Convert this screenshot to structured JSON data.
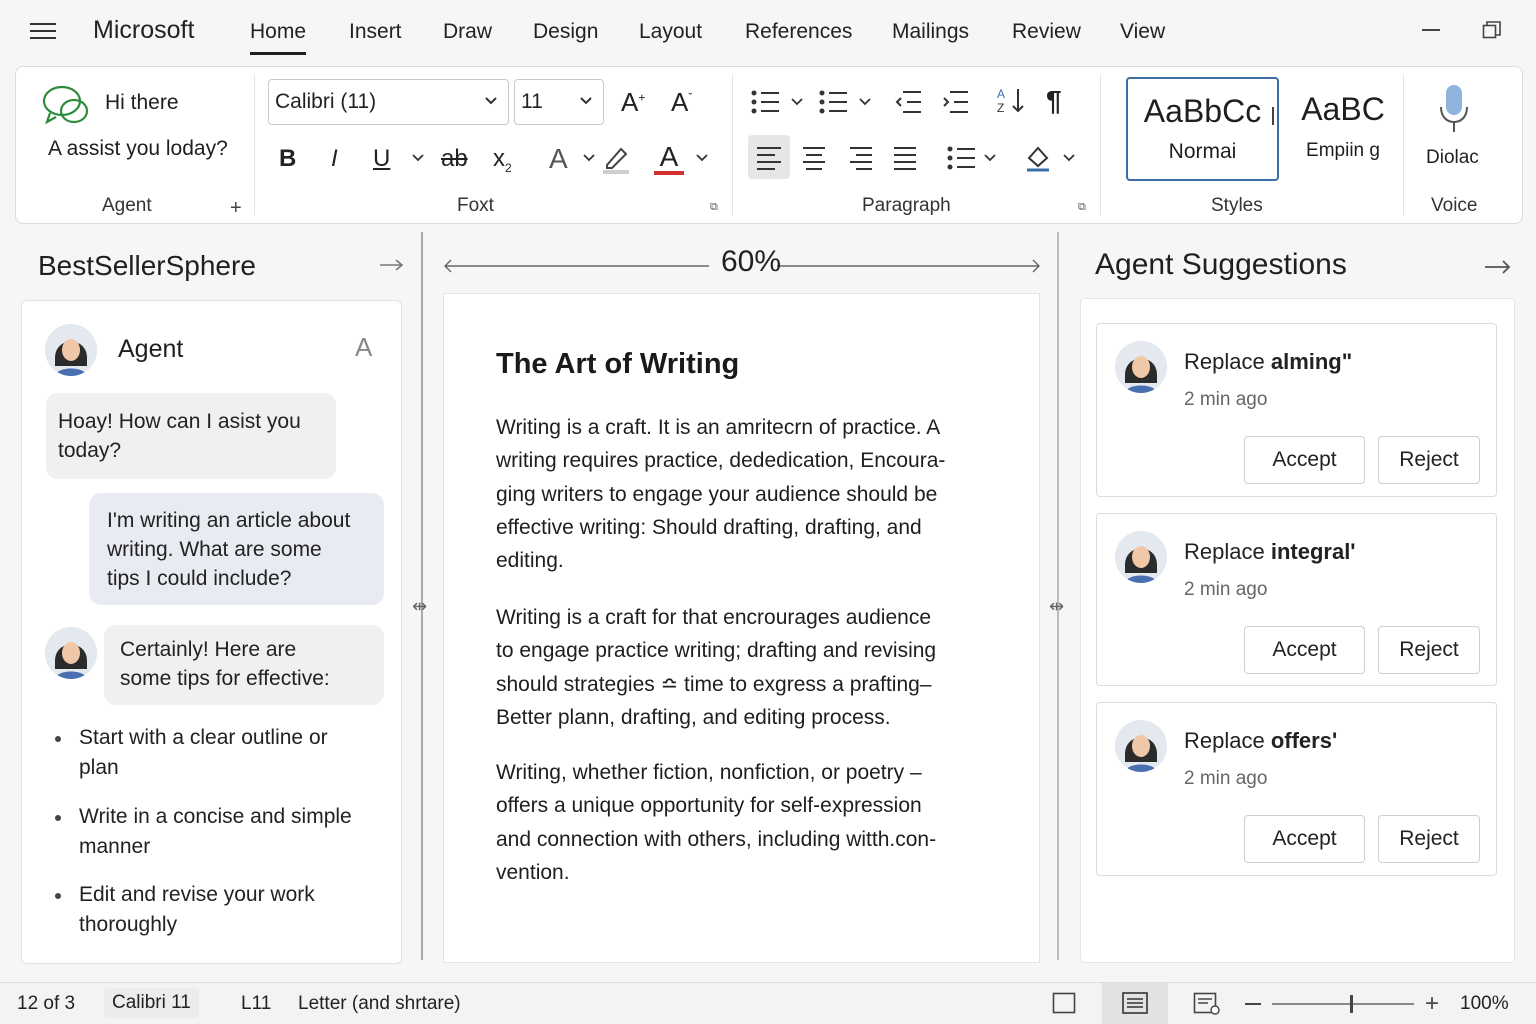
{
  "app": {
    "brand": "Microsoft"
  },
  "menu_tabs": [
    "Home",
    "Insert",
    "Draw",
    "Design",
    "Layout",
    "References",
    "Mailings",
    "Review",
    "View"
  ],
  "ribbon": {
    "agent": {
      "greeting": "Hi there",
      "prompt": "A assist you loday?",
      "label": "Agent"
    },
    "font": {
      "family": "Calibri (11)",
      "size": "11",
      "label": "Foxt"
    },
    "paragraph": {
      "label": "Paragraph"
    },
    "styles": {
      "normal_preview": "AaBbCc",
      "normal_name": "Normai",
      "emph_preview": "AaBC",
      "emph_name": "Empiin g",
      "label": "Styles"
    },
    "voice": {
      "name": "Diolac",
      "label": "Voice"
    }
  },
  "left_panel": {
    "title": "BestSellerSphere",
    "agent_name": "Agent",
    "agent_glyph": "A",
    "messages": {
      "m1": [
        "Hoay! How can I asist you",
        "today?"
      ],
      "m2": [
        "I'm writing an article about",
        "writing. What are some",
        "tips I could include?"
      ],
      "m3": [
        "Certainly! Here are",
        "some tips for effective:"
      ]
    },
    "tips": [
      [
        "Start with a clear outline or",
        "plan"
      ],
      [
        "Write in a concise and simple",
        "manner"
      ],
      [
        "Edit and revise your work",
        "thoroughly"
      ]
    ]
  },
  "document": {
    "zoom_label": "60%",
    "title": "The Art of Writing",
    "paragraphs": [
      [
        "Writing is a craft. It is an amritecrn of practice. A",
        "writing requires practice, dededication, Encoura-",
        "ging writers to engage your audience should be",
        "effective writing: Should drafting, drafting, and",
        "editing."
      ],
      [
        "Writing is a craft for that encrourages audience",
        "to engage practice writing; drafting and revising",
        "should strategies ≏ time to exgress a prafting–",
        "Better plann, drafting, and editing process."
      ],
      [
        "Writing, whether fiction, nonfiction, or poetry –",
        "offers a unique opportunity for self-expression",
        "and connection with others, including witth.con-",
        "vention."
      ]
    ]
  },
  "right_panel": {
    "title": "Agent Suggestions",
    "suggestions": [
      {
        "prefix": "Replace",
        "word": "alming\"",
        "time": "2 min ago",
        "accept": "Accept",
        "reject": "Reject"
      },
      {
        "prefix": "Replace",
        "word": "integral'",
        "time": "2 min ago",
        "accept": "Accept",
        "reject": "Reject"
      },
      {
        "prefix": "Replace",
        "word": "offers'",
        "time": "2 min ago",
        "accept": "Accept",
        "reject": "Reject"
      }
    ]
  },
  "status_bar": {
    "page": "12 of 3",
    "font": "Calibri 11",
    "line": "L11",
    "paper": "Letter (and shrtare)",
    "zoom": "100%"
  },
  "colors": {
    "accent_blue": "#3b6ea5",
    "font_color_red": "#d32f2f",
    "agent_green": "#2e8b3d"
  },
  "icons": [
    "hamburger-icon",
    "restore-icon",
    "chat-agent-icon",
    "bullets-icon",
    "numbering-icon",
    "microphone-icon"
  ]
}
